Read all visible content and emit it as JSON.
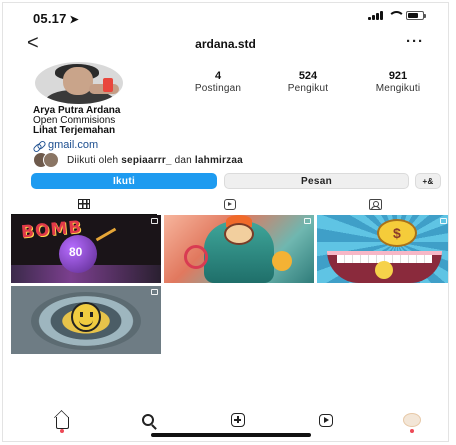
{
  "status_bar": {
    "time": "05.17",
    "location_glyph": "➤"
  },
  "header": {
    "back_glyph": "<",
    "username": "ardana.std",
    "more_glyph": "···"
  },
  "stats": [
    {
      "value": "4",
      "label": "Postingan"
    },
    {
      "value": "524",
      "label": "Pengikut"
    },
    {
      "value": "921",
      "label": "Mengikuti"
    }
  ],
  "bio": {
    "name": "Arya Putra Ardana",
    "line": "Open Commisions",
    "translate": "Lihat Terjemahan",
    "link": "gmail.com"
  },
  "followed_by": {
    "prefix": "Diikuti oleh ",
    "user1": "sepiaarrr_",
    "and": " dan ",
    "user2": "lahmirzaa"
  },
  "actions": {
    "follow": "Ikuti",
    "message": "Pesan",
    "add_user": "+&"
  },
  "tabs": [
    "grid",
    "reels",
    "tagged"
  ],
  "colors": {
    "accent": "#1e9bf0",
    "link": "#1c4e8f",
    "notification": "#ed4956"
  },
  "post_texts": {
    "post1_title": "BOMB"
  },
  "bottom_nav": [
    "home",
    "search",
    "create",
    "reels",
    "profile"
  ]
}
